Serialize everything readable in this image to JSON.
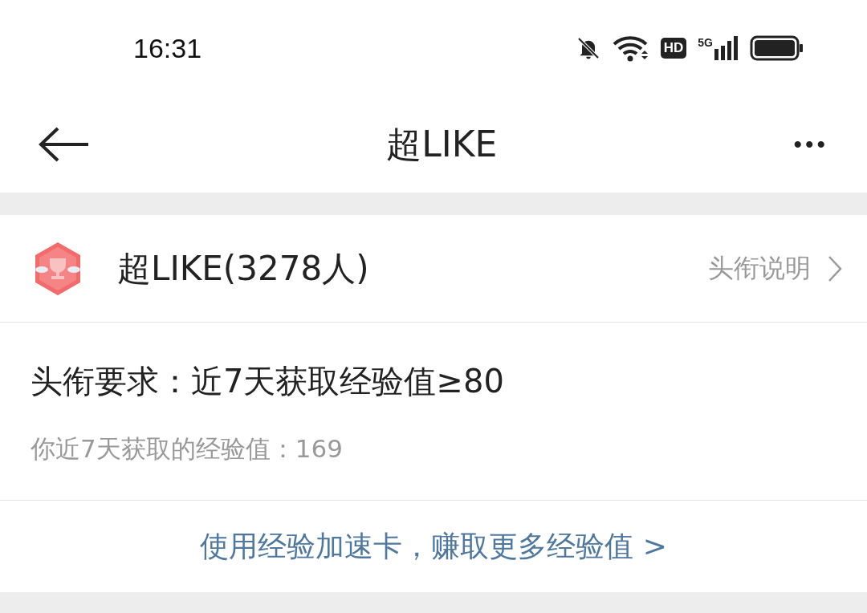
{
  "status_bar": {
    "time": "16:31",
    "hd": "HD",
    "network": "5G"
  },
  "header": {
    "title": "超LIKE",
    "more": "•••"
  },
  "title_row": {
    "name": "超LIKE(3278人)",
    "link": "头衔说明"
  },
  "requirement": {
    "text": "头衔要求：近7天获取经验值≥80",
    "progress": "你近7天获取的经验值：169"
  },
  "action_link": "使用经验加速卡，赚取更多经验值 >"
}
